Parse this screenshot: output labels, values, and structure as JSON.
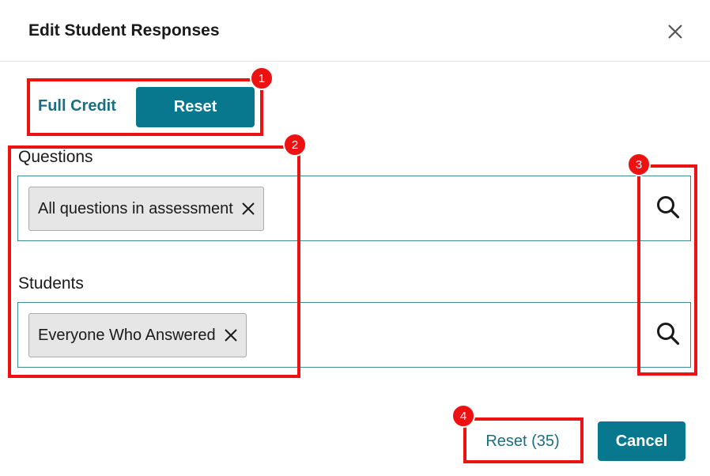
{
  "dialog": {
    "title": "Edit Student Responses",
    "close_icon": "close-icon"
  },
  "mode": {
    "full_credit_label": "Full Credit",
    "reset_label": "Reset"
  },
  "questions": {
    "label": "Questions",
    "chip": "All questions in assessment",
    "search_icon": "search-icon"
  },
  "students": {
    "label": "Students",
    "chip": "Everyone Who Answered",
    "search_icon": "search-icon"
  },
  "footer": {
    "reset_count_label": "Reset (35)",
    "cancel_label": "Cancel"
  },
  "annotations": [
    "1",
    "2",
    "3",
    "4"
  ],
  "colors": {
    "accent": "#07788e",
    "link": "#1a6e82",
    "callout": "#ee1111",
    "field_border": "#3f8c97",
    "chip_bg": "#e6e6e6"
  }
}
